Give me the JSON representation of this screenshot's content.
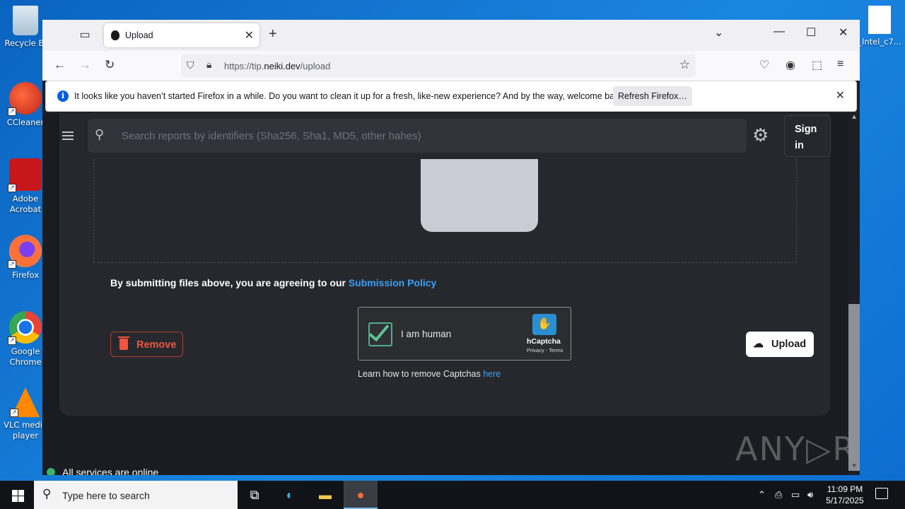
{
  "desktop": {
    "icons": [
      {
        "label": "Recycle Bi"
      },
      {
        "label": "CCleaner"
      },
      {
        "label": "Adobe Acrobat"
      },
      {
        "label": "Firefox"
      },
      {
        "label": "Google Chrome"
      },
      {
        "label": "VLC media player"
      },
      {
        "label": "_Intel_c7..."
      }
    ]
  },
  "browser": {
    "tab_title": "Upload",
    "url_prefix": "https://tip.",
    "url_domain": "neiki.dev",
    "url_path": "/upload",
    "notification": {
      "message": "It looks like you haven’t started Firefox in a while. Do you want to clean it up for a fresh, like-new experience? And by the way, welcome back!",
      "button": "Refresh Firefox…"
    }
  },
  "page": {
    "search_placeholder": "Search reports by identifiers (Sha256, Sha1, MD5, other hahes)",
    "sign_in": "Sign in",
    "policy_text": "By submitting files above, you are agreeing to our ",
    "policy_link": "Submission Policy",
    "remove_label": "Remove",
    "upload_label": "Upload",
    "captcha": {
      "label": "I am human",
      "brand": "hCaptcha",
      "terms": "Privacy - Terms"
    },
    "learn_text": "Learn how to remove Captchas ",
    "learn_link": "here",
    "status": "All services are online",
    "watermark": "ANY▷RUN"
  },
  "taskbar": {
    "search_placeholder": "Type here to search",
    "time": "11:09 PM",
    "date": "5/17/2025"
  },
  "colors": {
    "accent_link": "#3ba1f5",
    "remove_red": "#f2543f",
    "status_green": "#3cb36b"
  }
}
